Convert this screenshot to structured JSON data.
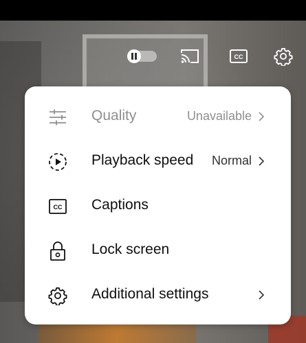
{
  "player": {
    "controls": {
      "autoplay_icon": "autoplay-toggle-icon",
      "cast_icon": "cast-icon",
      "captions_icon": "closed-captions-icon",
      "settings_icon": "gear-icon"
    }
  },
  "menu": {
    "items": [
      {
        "label": "Quality",
        "value": "Unavailable",
        "icon": "sliders-icon",
        "disabled": true,
        "has_chevron": true
      },
      {
        "label": "Playback speed",
        "value": "Normal",
        "icon": "playback-speed-icon",
        "disabled": false,
        "has_chevron": true
      },
      {
        "label": "Captions",
        "value": "",
        "icon": "captions-icon",
        "disabled": false,
        "has_chevron": false
      },
      {
        "label": "Lock screen",
        "value": "",
        "icon": "lock-icon",
        "disabled": false,
        "has_chevron": false
      },
      {
        "label": "Additional settings",
        "value": "",
        "icon": "gear-icon",
        "disabled": false,
        "has_chevron": true
      }
    ]
  },
  "colors": {
    "menu_background": "#ffffff",
    "text_primary": "#0f0f0f",
    "text_disabled": "#8f8f8f"
  }
}
